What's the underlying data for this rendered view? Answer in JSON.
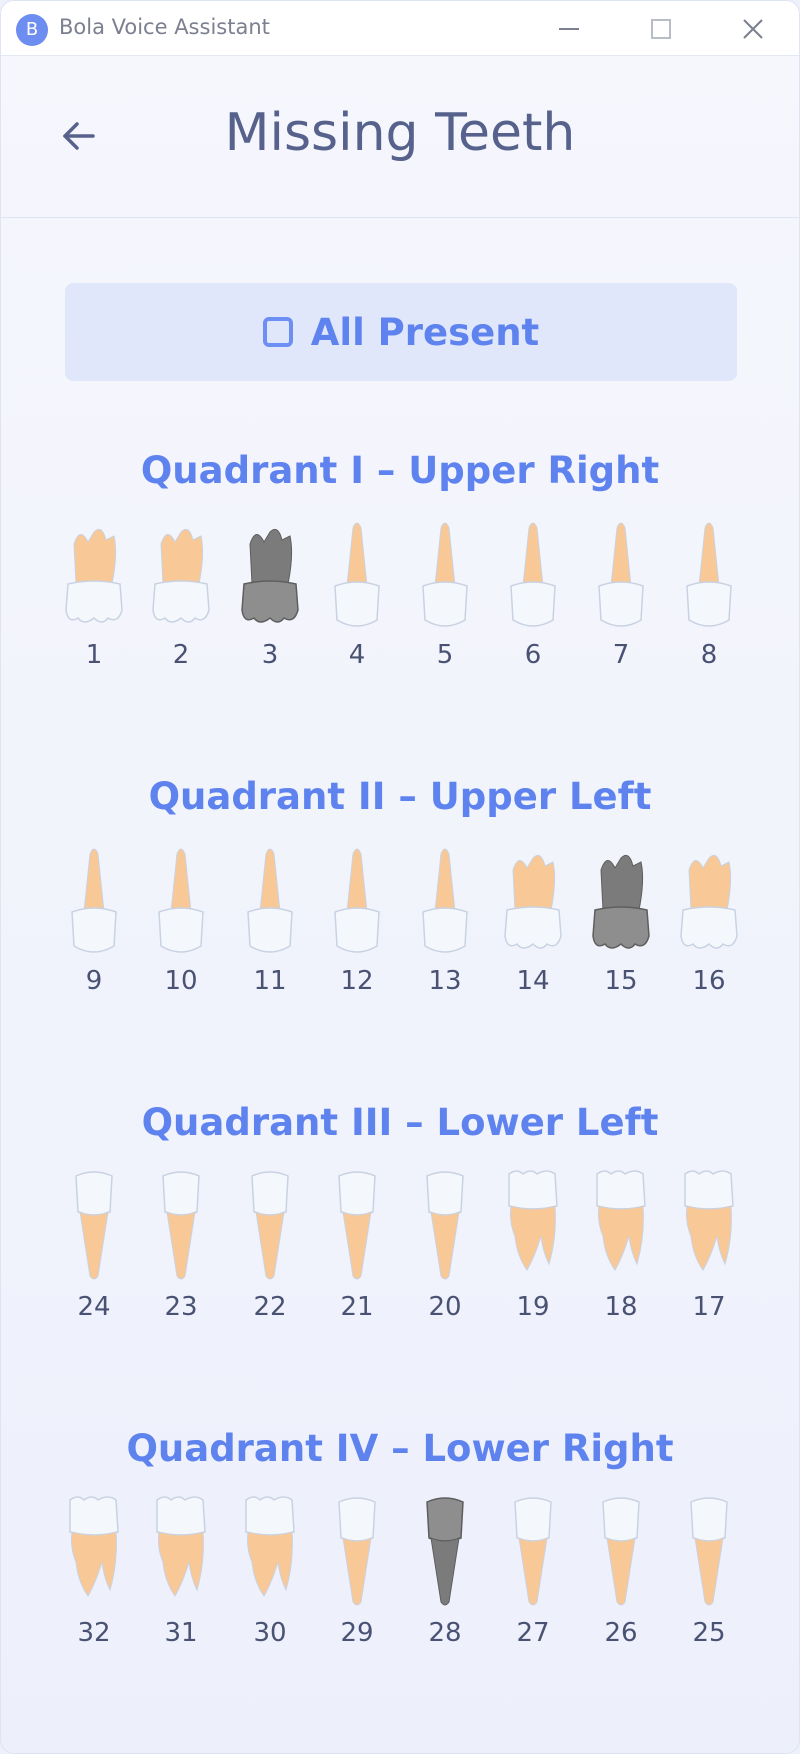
{
  "app": {
    "title": "Bola Voice Assistant",
    "logo_letter": "B"
  },
  "header": {
    "title": "Missing Teeth"
  },
  "all_present": {
    "label": "All Present",
    "checked": false
  },
  "colors": {
    "accent": "#5f83ee",
    "root": "#f8c896",
    "crown": "#f4f8fd",
    "missing": "#7b7b7b"
  },
  "quadrants": [
    {
      "title": "Quadrant I – Upper Right",
      "jaw": "upper",
      "teeth": [
        {
          "num": "1",
          "missing": false
        },
        {
          "num": "2",
          "missing": false
        },
        {
          "num": "3",
          "missing": true
        },
        {
          "num": "4",
          "missing": false
        },
        {
          "num": "5",
          "missing": false
        },
        {
          "num": "6",
          "missing": false
        },
        {
          "num": "7",
          "missing": false
        },
        {
          "num": "8",
          "missing": false
        }
      ]
    },
    {
      "title": "Quadrant II – Upper Left",
      "jaw": "upper",
      "teeth": [
        {
          "num": "9",
          "missing": false
        },
        {
          "num": "10",
          "missing": false
        },
        {
          "num": "11",
          "missing": false
        },
        {
          "num": "12",
          "missing": false
        },
        {
          "num": "13",
          "missing": false
        },
        {
          "num": "14",
          "missing": false
        },
        {
          "num": "15",
          "missing": true
        },
        {
          "num": "16",
          "missing": false
        }
      ]
    },
    {
      "title": "Quadrant III – Lower Left",
      "jaw": "lower",
      "teeth": [
        {
          "num": "24",
          "missing": false
        },
        {
          "num": "23",
          "missing": false
        },
        {
          "num": "22",
          "missing": false
        },
        {
          "num": "21",
          "missing": false
        },
        {
          "num": "20",
          "missing": false
        },
        {
          "num": "19",
          "missing": false
        },
        {
          "num": "18",
          "missing": false
        },
        {
          "num": "17",
          "missing": false
        }
      ]
    },
    {
      "title": "Quadrant IV – Lower Right",
      "jaw": "lower",
      "teeth": [
        {
          "num": "32",
          "missing": false
        },
        {
          "num": "31",
          "missing": false
        },
        {
          "num": "30",
          "missing": false
        },
        {
          "num": "29",
          "missing": false
        },
        {
          "num": "28",
          "missing": true
        },
        {
          "num": "27",
          "missing": false
        },
        {
          "num": "26",
          "missing": false
        },
        {
          "num": "25",
          "missing": false
        }
      ]
    }
  ]
}
